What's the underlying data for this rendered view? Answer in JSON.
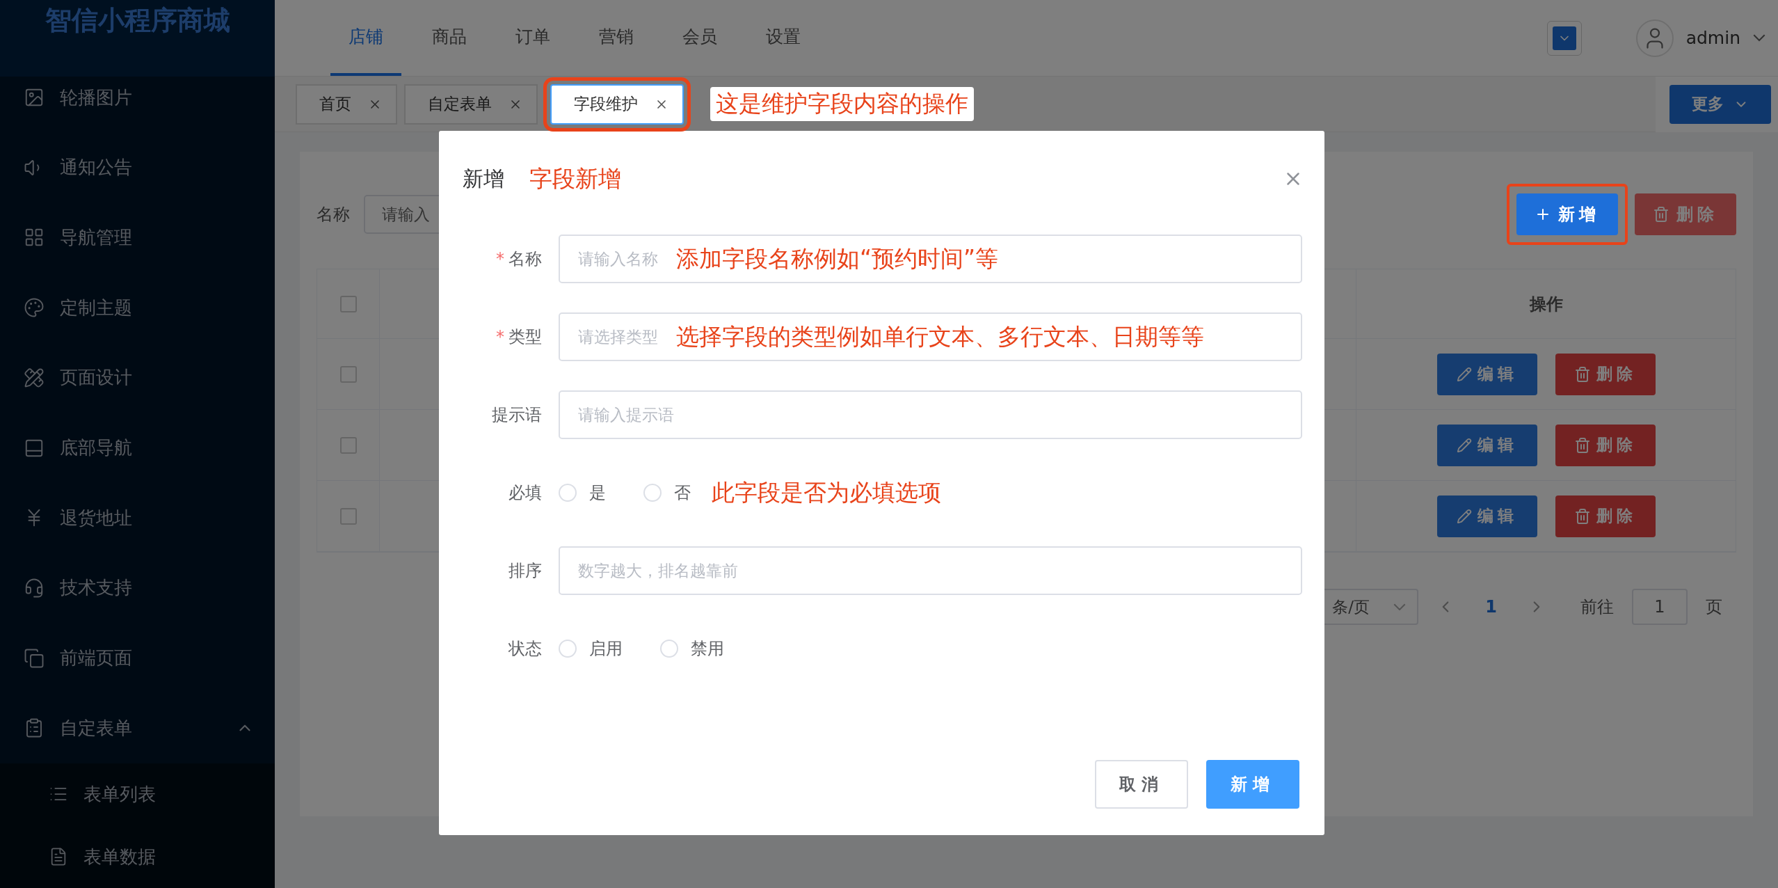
{
  "sidebar": {
    "logo": "智信小程序商城",
    "items": [
      {
        "label": "轮播图片"
      },
      {
        "label": "通知公告"
      },
      {
        "label": "导航管理"
      },
      {
        "label": "定制主题"
      },
      {
        "label": "页面设计"
      },
      {
        "label": "底部导航"
      },
      {
        "label": "退货地址"
      },
      {
        "label": "技术支持"
      },
      {
        "label": "前端页面"
      },
      {
        "label": "自定表单",
        "expanded": true,
        "children": [
          {
            "label": "表单列表"
          },
          {
            "label": "表单数据"
          }
        ]
      }
    ]
  },
  "top_nav": {
    "tabs": [
      {
        "label": "店铺",
        "selected": true
      },
      {
        "label": "商品",
        "selected": false
      },
      {
        "label": "订单",
        "selected": false
      },
      {
        "label": "营销",
        "selected": false
      },
      {
        "label": "会员",
        "selected": false
      },
      {
        "label": "设置",
        "selected": false
      }
    ],
    "user": "admin"
  },
  "page_tabs": {
    "tabs": [
      {
        "label": "首页",
        "selected": false,
        "highlighted": false
      },
      {
        "label": "自定表单",
        "selected": false,
        "highlighted": false
      },
      {
        "label": "字段维护",
        "selected": true,
        "highlighted": true
      }
    ],
    "note": "这是维护字段内容的操作",
    "more": "更多"
  },
  "filter": {
    "label": "名称",
    "placeholder": "请输入"
  },
  "toolbar": {
    "buttons": [
      {
        "label": "新增",
        "kind": "add",
        "highlighted": true
      },
      {
        "label": "删除",
        "kind": "delete",
        "highlighted": false
      }
    ]
  },
  "table": {
    "action_header": "操作",
    "header_checked": false,
    "rows": [
      {
        "checked": false,
        "actions": [
          {
            "label": "编辑",
            "kind": "edit"
          },
          {
            "label": "删除",
            "kind": "delete"
          }
        ]
      },
      {
        "checked": false,
        "actions": [
          {
            "label": "编辑",
            "kind": "edit"
          },
          {
            "label": "删除",
            "kind": "delete"
          }
        ]
      },
      {
        "checked": false,
        "actions": [
          {
            "label": "编辑",
            "kind": "edit"
          },
          {
            "label": "删除",
            "kind": "delete"
          }
        ]
      }
    ]
  },
  "pagination": {
    "page_size": "条/页",
    "current": "1",
    "goto_label": "前往",
    "goto_value": "1",
    "page_unit": "页"
  },
  "dialog": {
    "title": "新增",
    "note": "字段新增",
    "fields": [
      {
        "kind": "input",
        "label": "名称",
        "marker": "*",
        "placeholder": "请输入名称",
        "note": "添加字段名称例如“预约时间”等"
      },
      {
        "kind": "input",
        "label": "类型",
        "marker": "*",
        "placeholder": "请选择类型",
        "note": "选择字段的类型例如单行文本、多行文本、日期等等"
      },
      {
        "kind": "input",
        "label": "提示语",
        "placeholder": "请输入提示语"
      },
      {
        "kind": "radio",
        "label": "必填",
        "options": [
          {
            "label": "是",
            "selected": false
          },
          {
            "label": "否",
            "selected": false
          }
        ],
        "note": "此字段是否为必填选项"
      },
      {
        "kind": "input",
        "label": "排序",
        "placeholder": "数字越大，排名越靠前"
      },
      {
        "kind": "radio",
        "label": "状态",
        "options": [
          {
            "label": "启用",
            "selected": false
          },
          {
            "label": "禁用",
            "selected": false
          }
        ]
      }
    ],
    "buttons": [
      {
        "label": "取消",
        "kind": "cancel"
      },
      {
        "label": "新增",
        "kind": "confirm"
      }
    ]
  }
}
